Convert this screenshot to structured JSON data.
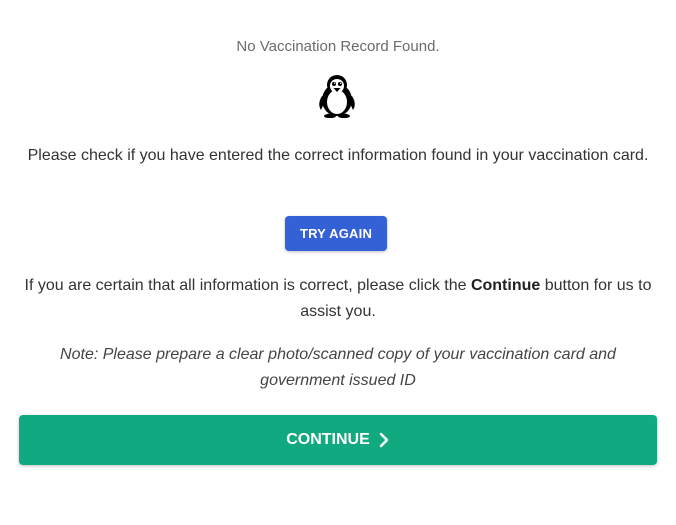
{
  "result": {
    "heading": "No Vaccination Record Found.",
    "mascot_icon": "penguin-icon"
  },
  "messages": {
    "check_info": "Please check if you have entered the correct information found in your vaccination card.",
    "certain_prefix": "If you are certain that all information is correct, please click the ",
    "certain_bold": "Continue",
    "certain_suffix": " button for us to assist you.",
    "note": "Note: Please prepare a clear photo/scanned copy of your vaccination card and government issued ID"
  },
  "actions": {
    "try_again_label": "TRY AGAIN",
    "continue_label": "CONTINUE",
    "continue_icon": "chevron-right-icon"
  },
  "colors": {
    "try_again_bg": "#3461d6",
    "continue_bg": "#10a980",
    "heading_text": "#6b6b6b",
    "body_text": "#333333"
  }
}
